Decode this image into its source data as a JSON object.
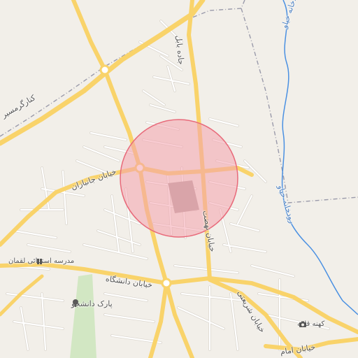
{
  "map": {
    "colors": {
      "land": "#f2efe9",
      "major_road": "#f9d36a",
      "minor_road": "#ffffff",
      "minor_road_casing": "#d9d4cc",
      "river": "#4a90e2",
      "boundary": "#9a9aaa",
      "park": "#c9e5b9",
      "highlight_fill": "#f4a3ad",
      "highlight_stroke": "#e86a7a"
    },
    "streets": {
      "jade_babol": "جاده بابل",
      "garmsir": "کنارگرمسیر",
      "janbazan": "خیابان جانبازان",
      "daneshgah": "خیابان دانشگاه",
      "hesmat": "خیابان نهضت",
      "shariati": "خیابان شریعتی",
      "imam": "خیابان امام"
    },
    "water": {
      "river_north": "رودخانه خیاو",
      "river_south": "رودخانه خیاو"
    },
    "pois": [
      {
        "label": "مدرسه استثنائی لقمان",
        "icon": "school-icon"
      },
      {
        "label": "پارک دانشجو",
        "icon": "tree-icon"
      },
      {
        "label": "کهنه قلعه",
        "icon": "camera-icon"
      }
    ]
  }
}
